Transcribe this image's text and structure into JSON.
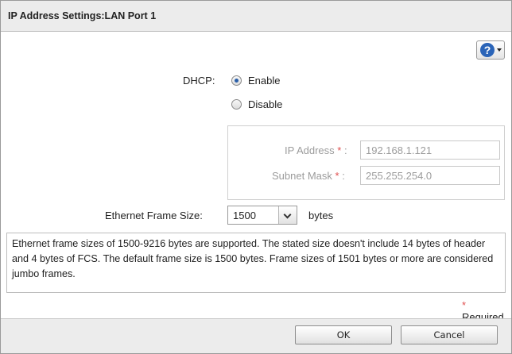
{
  "dialog": {
    "title": "IP Address Settings:LAN Port 1"
  },
  "help": {
    "icon_glyph": "?"
  },
  "dhcp": {
    "label": "DHCP:",
    "options": [
      "Enable",
      "Disable"
    ],
    "selected": "Enable"
  },
  "ip_fields": {
    "ip_address_label": "IP Address",
    "ip_address_value": "192.168.1.121",
    "subnet_mask_label": "Subnet Mask",
    "subnet_mask_value": "255.255.254.0",
    "required_mark": "*",
    "colon": ":"
  },
  "frame_size": {
    "label": "Ethernet Frame Size:",
    "value": "1500",
    "unit": "bytes"
  },
  "info_text": "Ethernet frame sizes of 1500-9216 bytes are supported. The stated size doesn't include 14 bytes of header and 4 bytes of FCS. The default frame size is 1500 bytes. Frame sizes of 1501 bytes or more are considered jumbo frames.",
  "required_note": {
    "mark": "*",
    "text": "Required"
  },
  "buttons": {
    "ok": "OK",
    "cancel": "Cancel"
  },
  "colors": {
    "required_asterisk": "#e05050",
    "radio_selected": "#2a5fa8",
    "help_icon": "#2a64b8"
  }
}
